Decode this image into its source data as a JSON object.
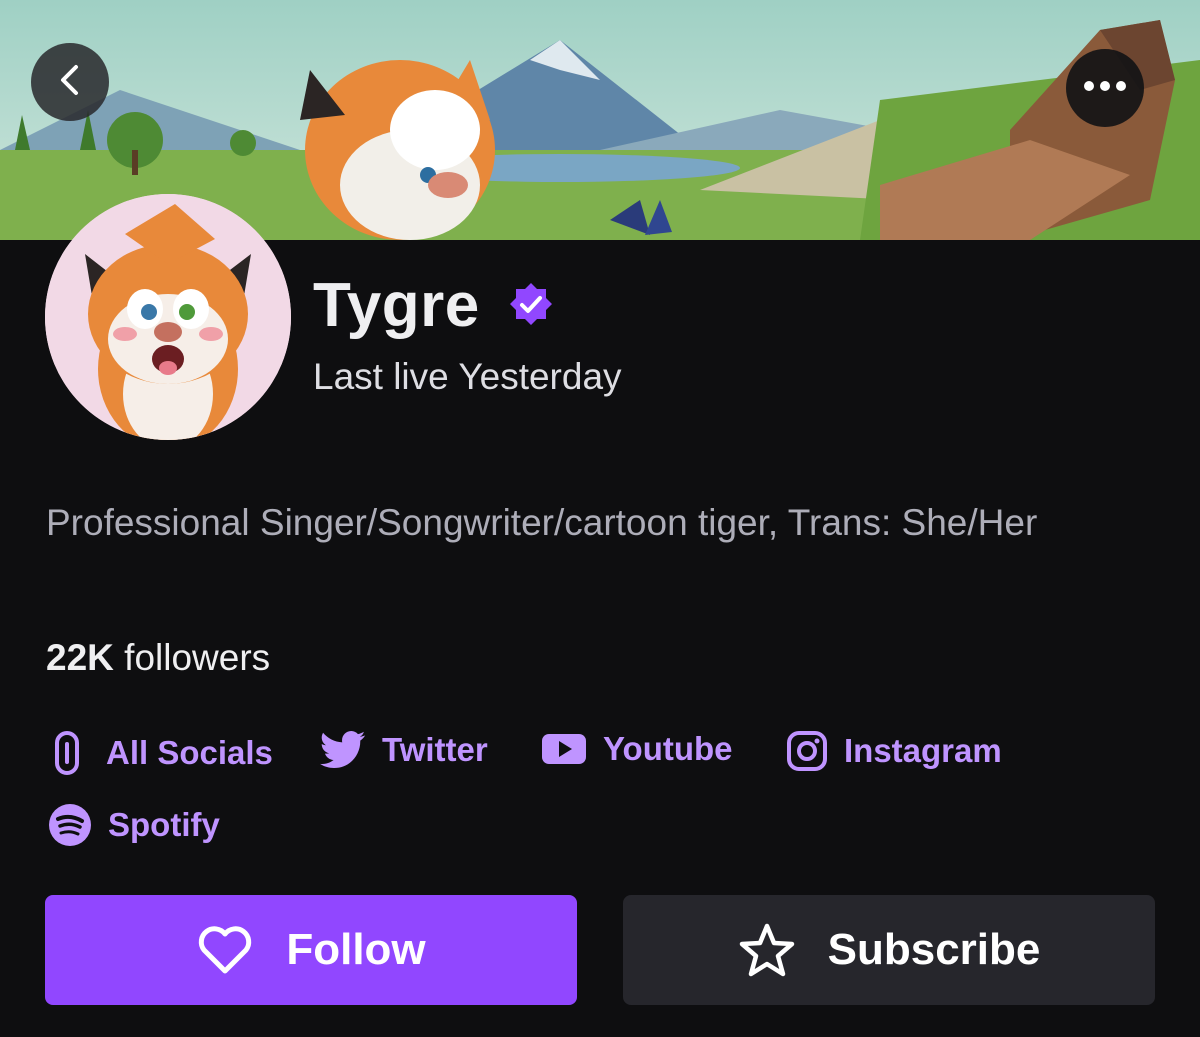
{
  "channel": {
    "name": "Tygre",
    "last_live": "Last live Yesterday",
    "bio": "Professional Singer/Songwriter/cartoon tiger, Trans: She/Her",
    "followers_count": "22K",
    "followers_label": "followers"
  },
  "socials": [
    {
      "label": "All Socials",
      "icon": "link-icon"
    },
    {
      "label": "Twitter",
      "icon": "twitter-icon"
    },
    {
      "label": "Youtube",
      "icon": "youtube-icon"
    },
    {
      "label": "Instagram",
      "icon": "instagram-icon"
    },
    {
      "label": "Spotify",
      "icon": "spotify-icon"
    }
  ],
  "actions": {
    "follow_label": "Follow",
    "subscribe_label": "Subscribe"
  },
  "colors": {
    "background": "#0e0e10",
    "accent": "#9147ff",
    "link": "#bf94ff",
    "secondary_button": "#26262c"
  }
}
